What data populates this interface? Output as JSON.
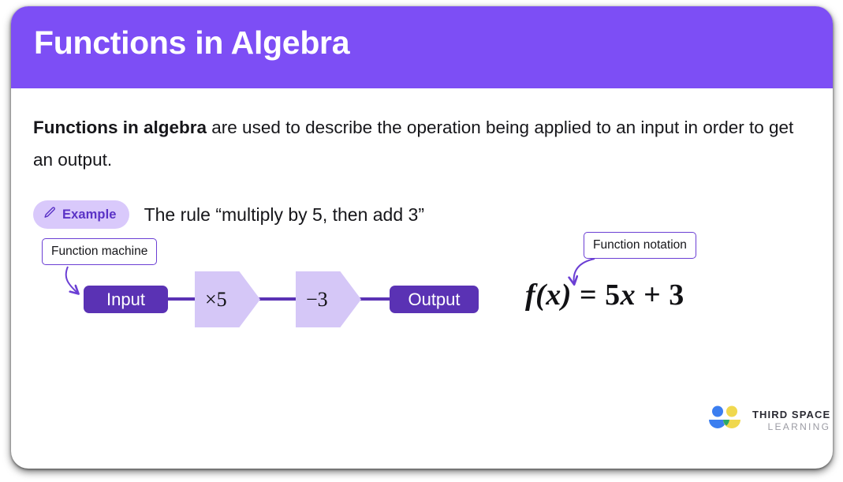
{
  "header": {
    "title": "Functions in Algebra",
    "background_color": "#7d4ef5",
    "text_color": "#ffffff"
  },
  "intro": {
    "bold_lead": "Functions in algebra",
    "rest": " are used to describe the operation being applied to an input in order to get an output."
  },
  "example": {
    "badge_icon": "pencil-icon",
    "badge_label": "Example",
    "badge_bg": "#d9c9fb",
    "badge_text_color": "#5a32c6",
    "text": "The rule “multiply by 5, then add 3”"
  },
  "diagram": {
    "callout_machine": "Function machine",
    "callout_notation": "Function notation",
    "input_label": "Input",
    "output_label": "Output",
    "operation_1": "×5",
    "operation_2": "−3",
    "pill_color": "#5a32b4",
    "machine_color": "#d5c7f7",
    "equation": {
      "fx": "f(x)",
      "equals": " = 5",
      "var": "x",
      "tail": " + 3"
    }
  },
  "logo": {
    "icon": "third-space-learning-logo-icon",
    "line1": "THIRD SPACE",
    "line2": "LEARNING",
    "blue": "#3b7ef0",
    "yellow": "#f0d84e",
    "green": "#2aa86a"
  }
}
